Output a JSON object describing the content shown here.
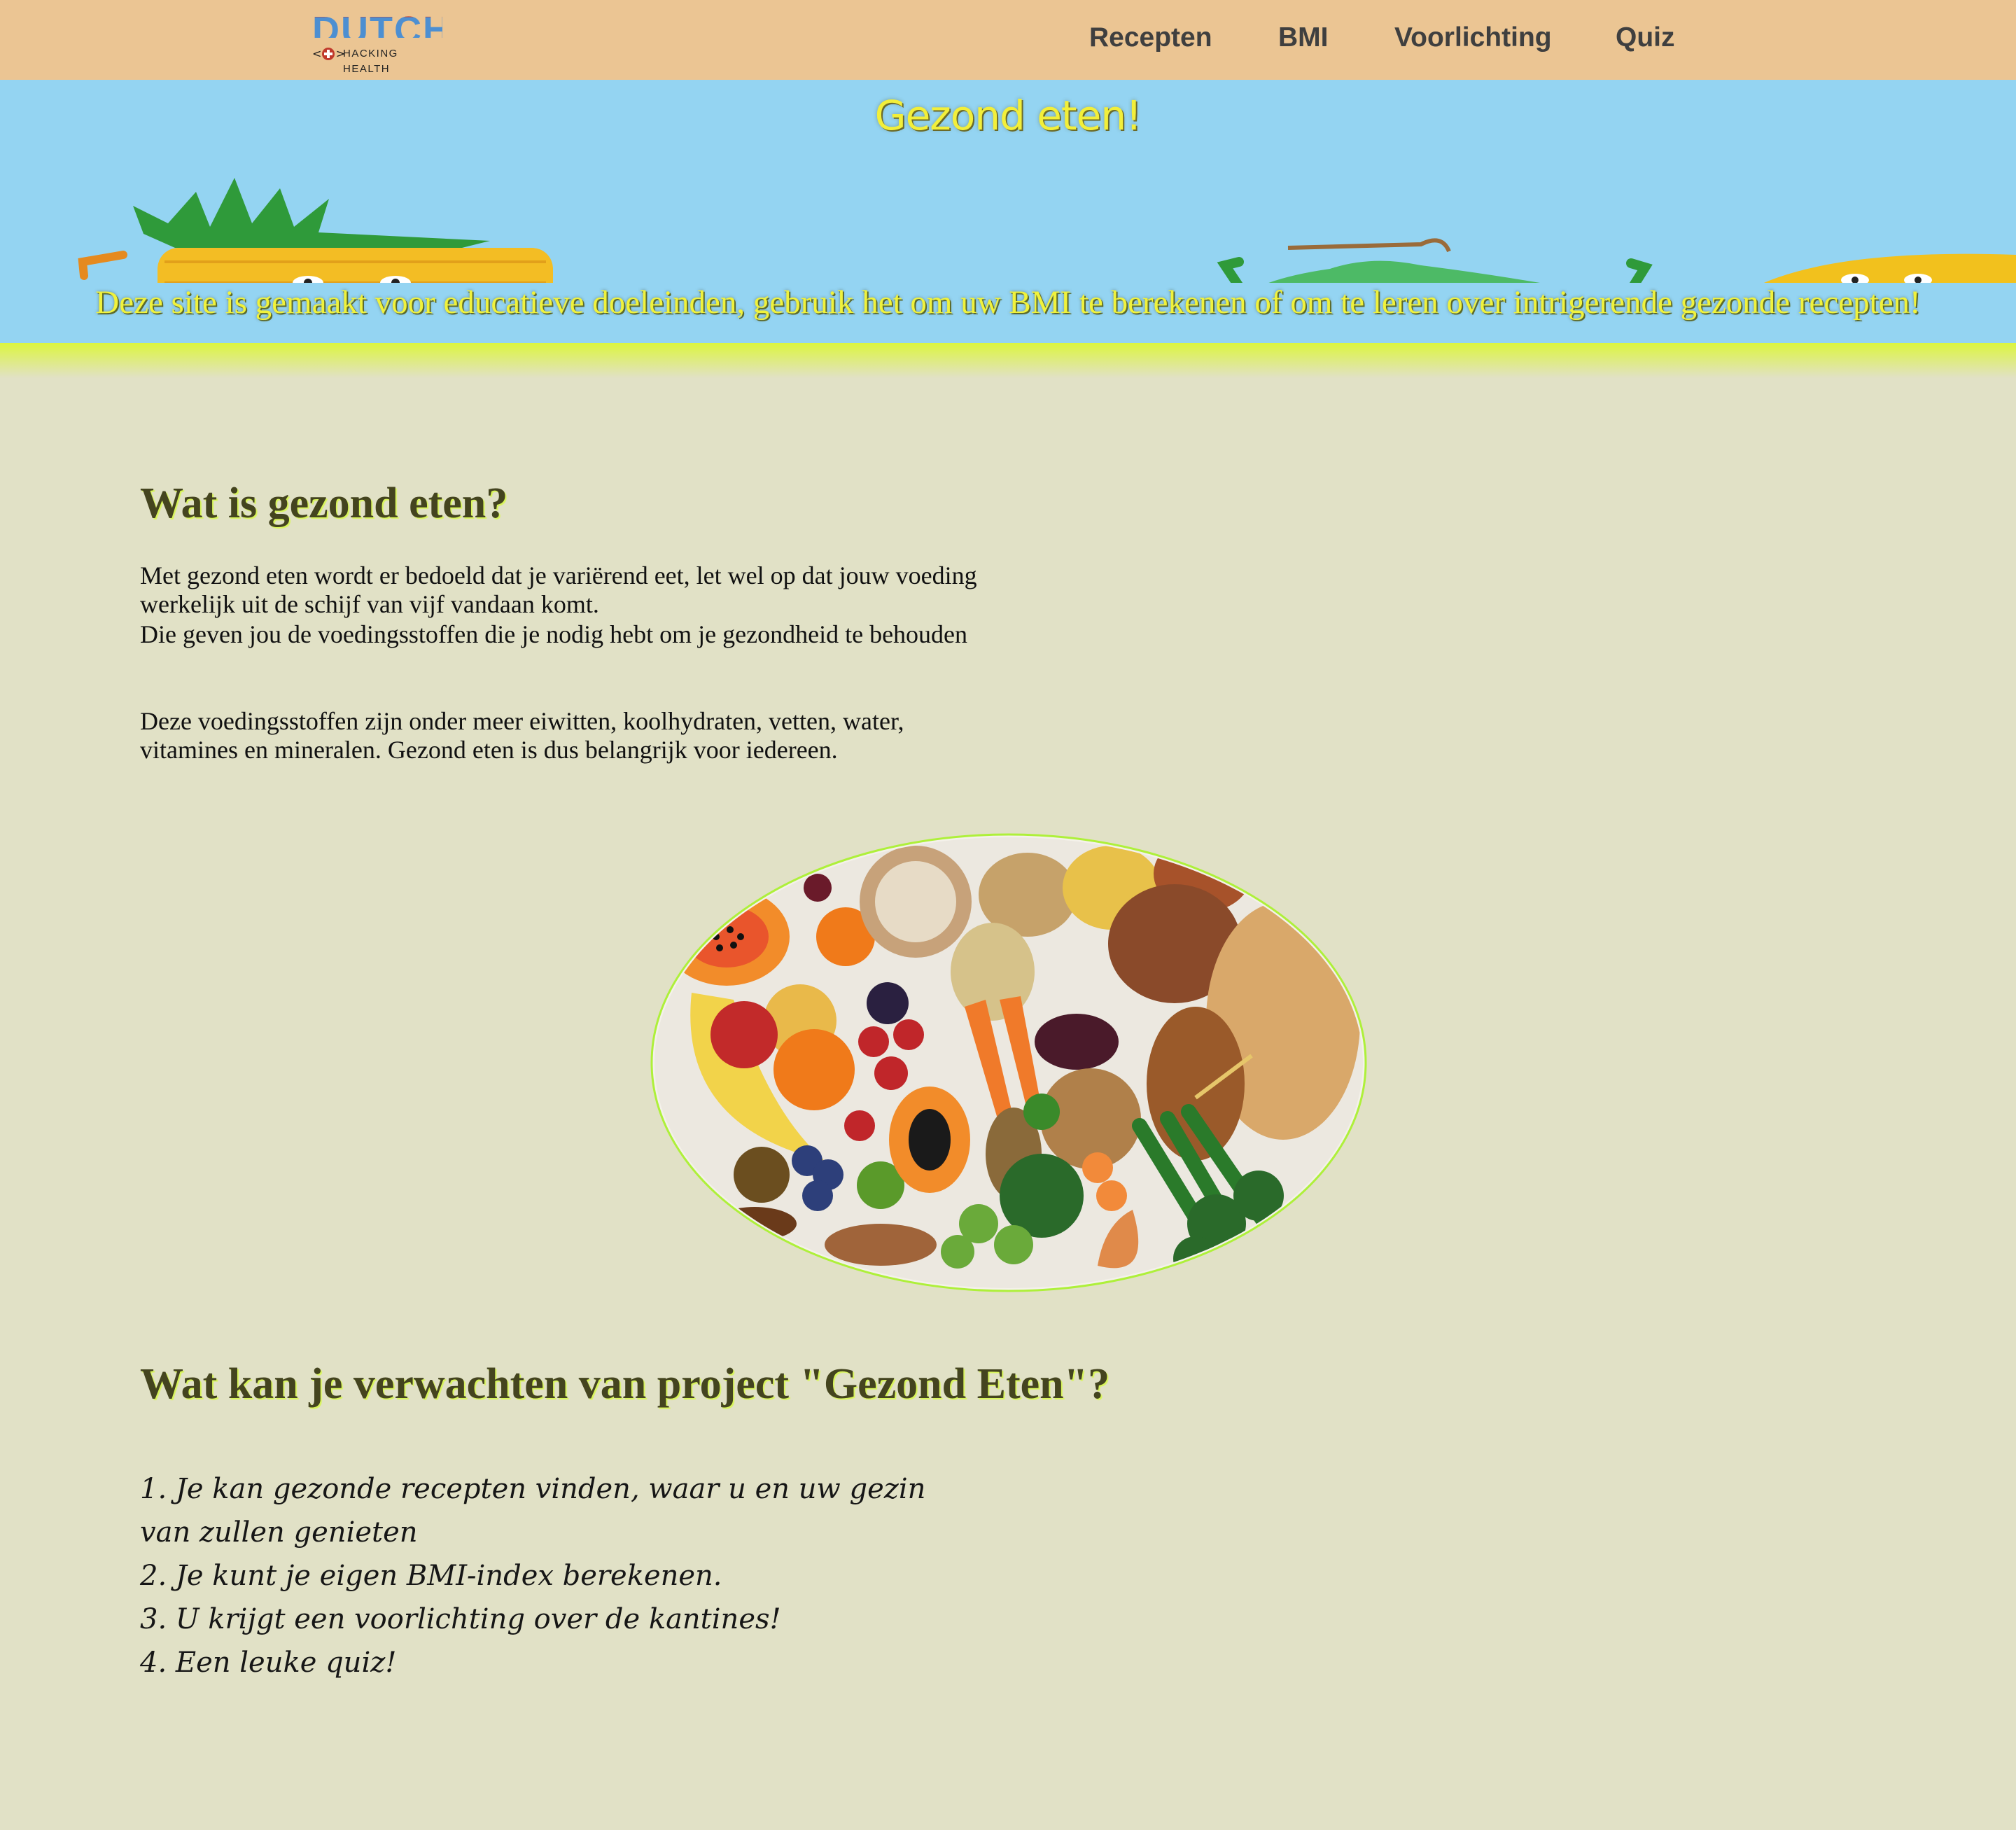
{
  "header": {
    "logo": {
      "wordmark": "DUTCH",
      "tagline": "HACKING HEALTH",
      "arrows": "<+>"
    },
    "nav": [
      {
        "label": "Recepten"
      },
      {
        "label": "BMI"
      },
      {
        "label": "Voorlichting"
      },
      {
        "label": "Quiz"
      }
    ]
  },
  "hero": {
    "title": "Gezond eten!",
    "subtitle": "Deze site is gemaakt voor educatieve doeleinden, gebruik het om uw BMI te berekenen of om te leren over intrigerende gezonde recepten!",
    "characters": [
      "pineapple",
      "strawberry",
      "pear",
      "banana"
    ]
  },
  "section1": {
    "heading": "Wat is gezond eten?",
    "paragraphs": [
      "Met gezond eten wordt er bedoeld dat je variërend eet, let wel op dat jouw voeding werkelijk uit de schijf van vijf vandaan komt.",
      "Die geven jou de voedingsstoffen die je nodig hebt om je gezondheid te behouden",
      "Deze voedingsstoffen zijn onder meer eiwitten, koolhydraten, vetten, water, vitamines en mineralen. Gezond eten is dus belangrijk voor iedereen."
    ]
  },
  "section2": {
    "heading": "Wat kan je verwachten van project \"Gezond Eten\"?",
    "items": [
      "1. Je kan gezonde recepten vinden, waar u en uw gezin van zullen genieten",
      "2. Je kunt je eigen BMI-index berekenen.",
      "3. U krijgt een voorlichting over de kantines!",
      "4. Een leuke quiz!"
    ]
  },
  "colors": {
    "nav_bg": "#ebc593",
    "hero_bg": "#94d4f2",
    "hero_text": "#f0f23c",
    "page_bg": "#e1e1c6",
    "heading": "#44441f",
    "heading_glow": "#d8f55a",
    "plate_border": "#aef03a"
  }
}
